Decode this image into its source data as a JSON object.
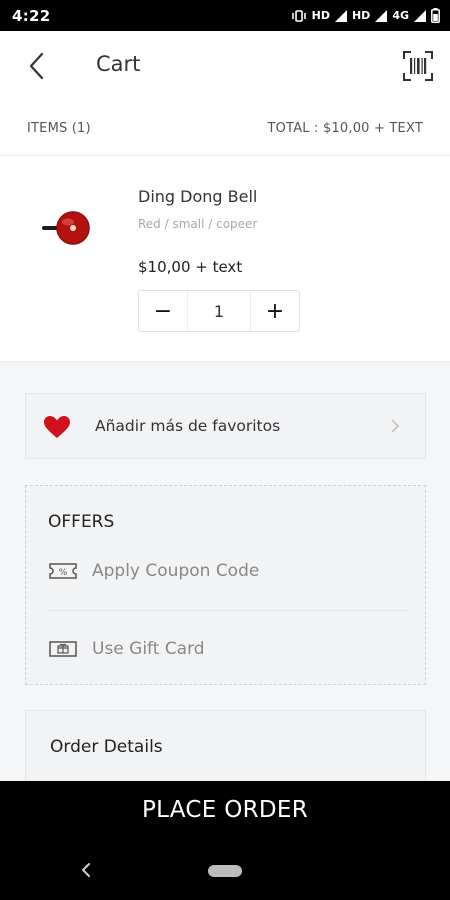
{
  "status_bar": {
    "time": "4:22",
    "network_labels": [
      "HD",
      "HD",
      "4G"
    ]
  },
  "header": {
    "title": "Cart",
    "back_icon": "chevron-left-icon",
    "barcode_icon": "barcode-scan-icon"
  },
  "summary": {
    "items_label": "ITEMS (1)",
    "total_label": "TOTAL : $10,00  + TEXT"
  },
  "cart": {
    "items": [
      {
        "name": "Ding Dong Bell",
        "variant": "Red / small / copeer",
        "price": "$10,00  + text",
        "quantity": "1",
        "image_icon": "bicycle-bell-image"
      }
    ],
    "minus_label": "−",
    "plus_label": "+"
  },
  "favorites": {
    "label": "Añadir más de favoritos",
    "icon": "heart-icon",
    "accent_color": "#d0101a"
  },
  "offers": {
    "title": "OFFERS",
    "coupon_label": "Apply Coupon Code",
    "gift_card_label": "Use Gift Card"
  },
  "order_details": {
    "title": "Order Details"
  },
  "cta": {
    "place_order_label": "PLACE ORDER"
  },
  "colors": {
    "primary": "#000000",
    "background": "#ffffff",
    "panel": "#f2f3f5"
  }
}
